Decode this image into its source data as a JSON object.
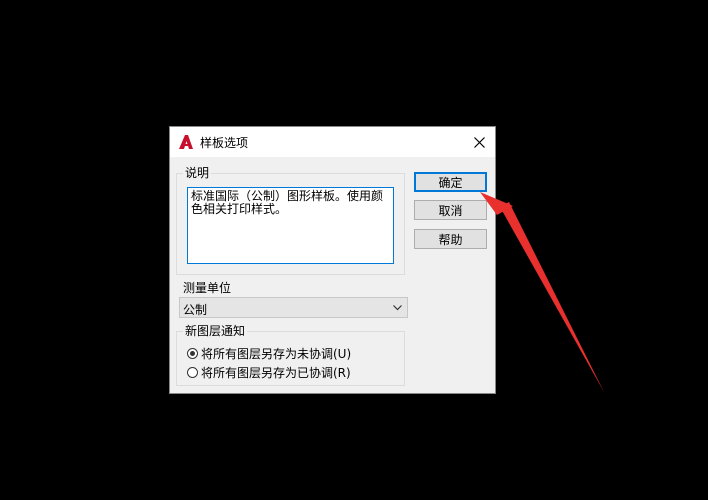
{
  "dialog": {
    "title": "样板选项",
    "app_icon": "autocad-logo-icon",
    "close_icon": "close-icon"
  },
  "description": {
    "legend": "说明",
    "text": "标准国际（公制）图形样板。使用颜色相关打印样式。"
  },
  "measurement": {
    "label": "测量单位",
    "selected": "公制",
    "dropdown_icon": "chevron-down-icon"
  },
  "layer_notification": {
    "legend": "新图层通知",
    "options": [
      {
        "label": "将所有图层另存为未协调(U)",
        "checked": true
      },
      {
        "label": "将所有图层另存为已协调(R)",
        "checked": false
      }
    ]
  },
  "buttons": {
    "ok": "确定",
    "cancel": "取消",
    "help": "帮助"
  },
  "annotation": {
    "arrow_color": "#e8312f",
    "arrow_icon": "red-arrow-annotation"
  },
  "colors": {
    "background": "#000000",
    "dialog_bg": "#f0f0f0",
    "accent": "#0078d7",
    "logo_red": "#c8102e"
  }
}
